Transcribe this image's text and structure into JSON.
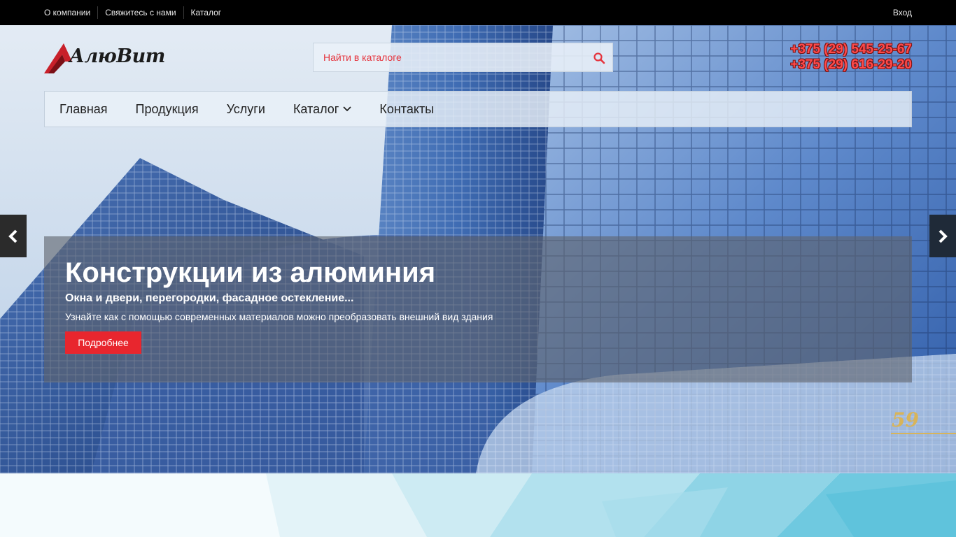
{
  "topbar": {
    "links": [
      "О компании",
      "Свяжитесь с нами",
      "Каталог"
    ],
    "login": "Вход"
  },
  "header": {
    "logo_text": "АлюВит",
    "search_placeholder": "Найти в каталоге",
    "phones": [
      "+375 (29) 545-25-67",
      "+375 (29) 616-29-20"
    ]
  },
  "nav": {
    "items": [
      "Главная",
      "Продукция",
      "Услуги",
      "Каталог",
      "Контакты"
    ]
  },
  "slide": {
    "title": "Конструкции из алюминия",
    "subtitle": "Окна и двери, перегородки, фасадное остекление...",
    "text": "Узнайте как с помощью современных материалов можно преобразовать внешний вид здания",
    "button": "Подробнее",
    "building_number": "59"
  },
  "colors": {
    "accent": "#e8262e",
    "topbar_bg": "#000000",
    "phone": "#ff4a4a"
  },
  "icons": {
    "search": "search-icon",
    "prev": "chevron-left-icon",
    "next": "chevron-right-icon",
    "dropdown": "chevron-down-icon"
  }
}
